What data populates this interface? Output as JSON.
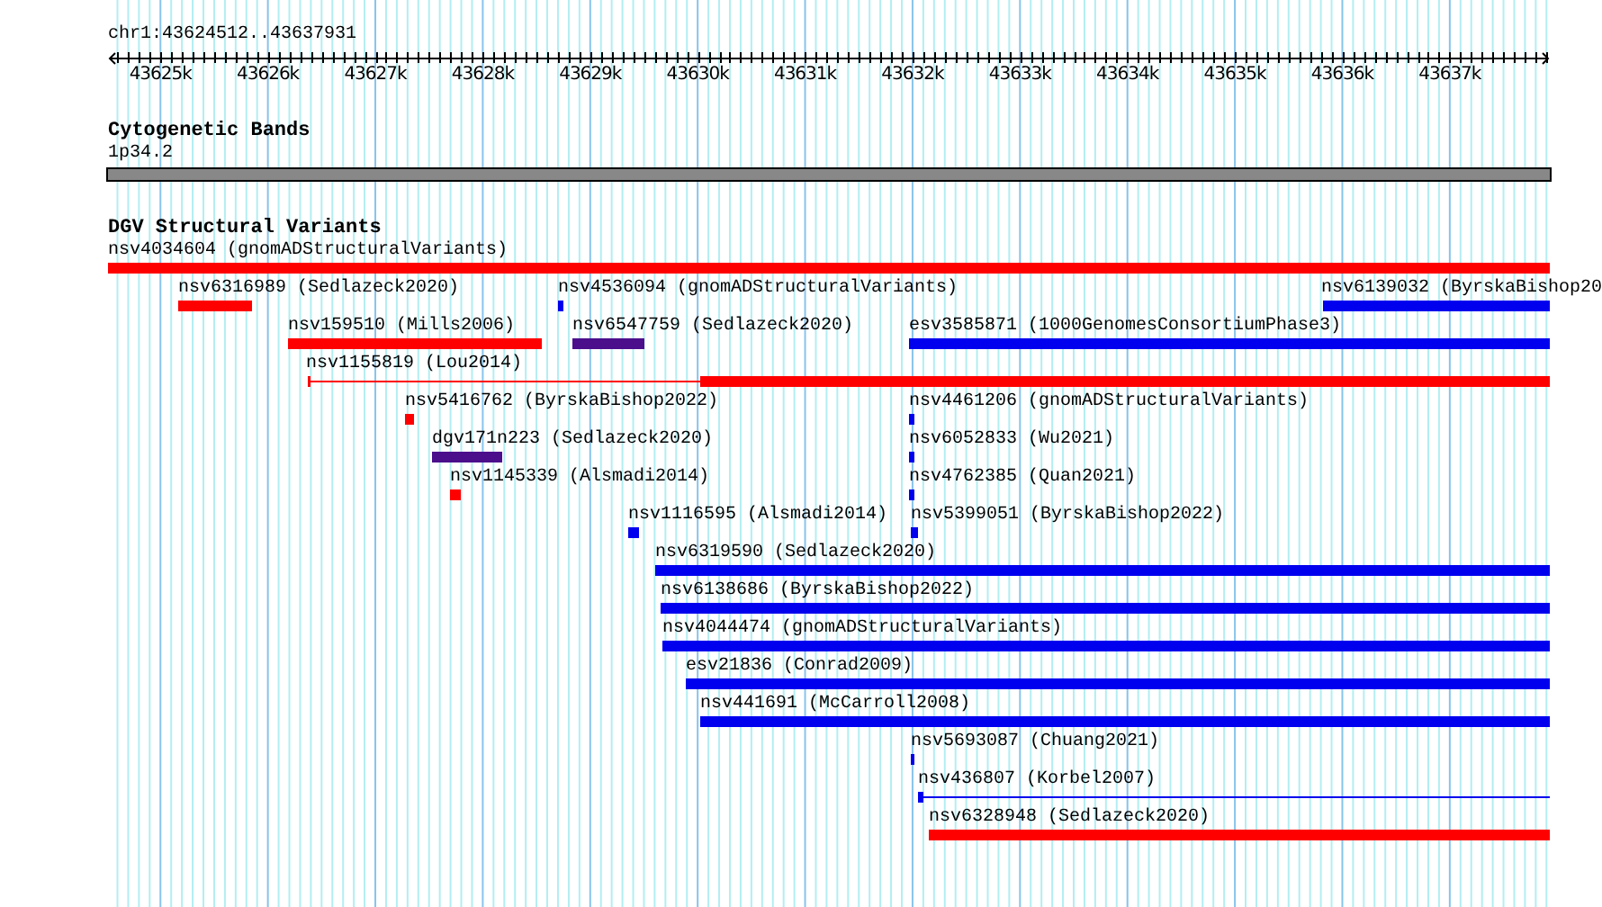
{
  "ruler": {
    "location": "chr1:43624512..43637931",
    "tick_labels": [
      "43625k",
      "43626k",
      "43627k",
      "43628k",
      "43629k",
      "43630k",
      "43631k",
      "43632k",
      "43633k",
      "43634k",
      "43635k",
      "43636k",
      "43637k"
    ]
  },
  "cytogenetic_bands": {
    "title": "Cytogenetic Bands",
    "band": "1p34.2"
  },
  "dgv": {
    "title": "DGV Structural Variants",
    "features": [
      {
        "label": "nsv4034604 (gnomADStructuralVariants)",
        "color": "#ff0000",
        "kind": "block"
      },
      {
        "label": "nsv6316989 (Sedlazeck2020)",
        "color": "#ff0000",
        "kind": "block"
      },
      {
        "label": "nsv4536094 (gnomADStructuralVariants)",
        "color": "#0000ee",
        "kind": "block"
      },
      {
        "label": "nsv6139032 (ByrskaBishop20",
        "color": "#0000ee",
        "kind": "block"
      },
      {
        "label": "nsv159510 (Mills2006)",
        "color": "#ff0000",
        "kind": "block"
      },
      {
        "label": "nsv6547759 (Sedlazeck2020)",
        "color": "#4b0f8c",
        "kind": "block"
      },
      {
        "label": "esv3585871 (1000GenomesConsortiumPhase3)",
        "color": "#0000ee",
        "kind": "block"
      },
      {
        "label": "nsv1155819 (Lou2014)",
        "color": "#ff0000",
        "kind": "split"
      },
      {
        "label": "nsv5416762 (ByrskaBishop2022)",
        "color": "#ff0000",
        "kind": "block"
      },
      {
        "label": "nsv4461206 (gnomADStructuralVariants)",
        "color": "#0000ee",
        "kind": "block"
      },
      {
        "label": "dgv171n223 (Sedlazeck2020)",
        "color": "#4b0f8c",
        "kind": "block"
      },
      {
        "label": "nsv6052833 (Wu2021)",
        "color": "#0000ee",
        "kind": "block"
      },
      {
        "label": "nsv1145339 (Alsmadi2014)",
        "color": "#ff0000",
        "kind": "block"
      },
      {
        "label": "nsv4762385 (Quan2021)",
        "color": "#0000ee",
        "kind": "block"
      },
      {
        "label": "nsv1116595 (Alsmadi2014)",
        "color": "#0000ee",
        "kind": "block"
      },
      {
        "label": "nsv5399051 (ByrskaBishop2022)",
        "color": "#0000ee",
        "kind": "block"
      },
      {
        "label": "nsv6319590 (Sedlazeck2020)",
        "color": "#0000ee",
        "kind": "block"
      },
      {
        "label": "nsv6138686 (ByrskaBishop2022)",
        "color": "#0000ee",
        "kind": "block"
      },
      {
        "label": "nsv4044474 (gnomADStructuralVariants)",
        "color": "#0000ee",
        "kind": "block"
      },
      {
        "label": "esv21836 (Conrad2009)",
        "color": "#0000ee",
        "kind": "block"
      },
      {
        "label": "nsv441691 (McCarroll2008)",
        "color": "#0000ee",
        "kind": "block"
      },
      {
        "label": "nsv5693087 (Chuang2021)",
        "color": "#0000ee",
        "kind": "block"
      },
      {
        "label": "nsv436807 (Korbel2007)",
        "color": "#0000ee",
        "kind": "split"
      },
      {
        "label": "nsv6328948 (Sedlazeck2020)",
        "color": "#ff0000",
        "kind": "block"
      }
    ]
  }
}
